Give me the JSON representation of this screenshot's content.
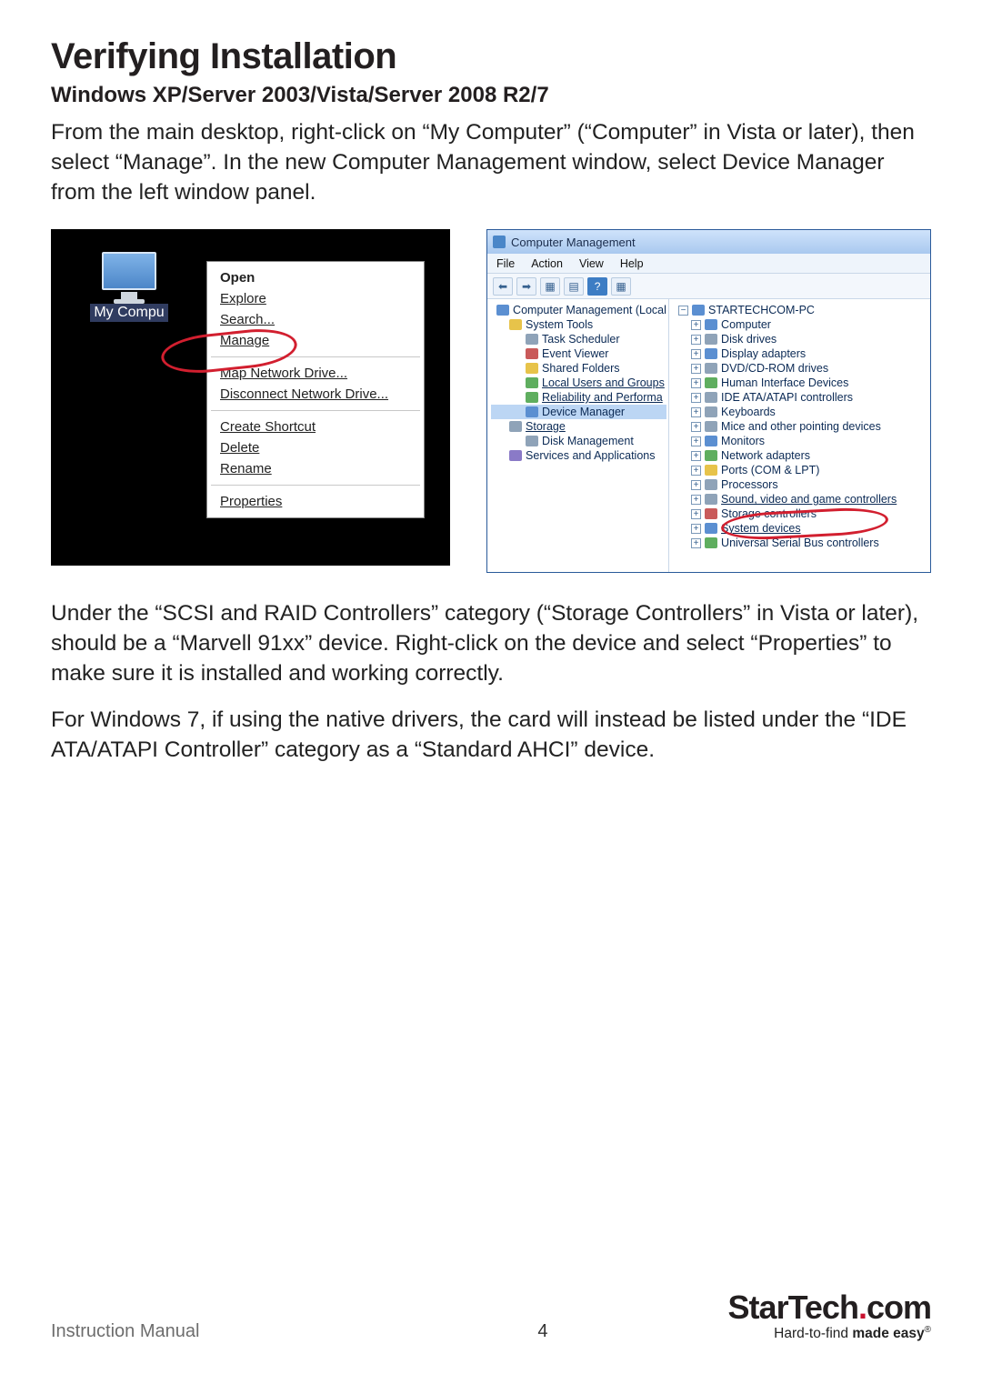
{
  "heading": "Verifying Installation",
  "subheading": "Windows XP/Server 2003/Vista/Server 2008 R2/7",
  "para1": "From the main desktop, right-click on “My Computer” (“Computer” in Vista or later), then select “Manage”. In the new Computer Management window, select Device Manager from the left window panel.",
  "para2": "Under the “SCSI and RAID Controllers” category (“Storage Controllers” in Vista or later), should be a “Marvell 91xx” device.  Right-click on the device and select “Properties” to make sure it is installed and working correctly.",
  "para3": "For Windows 7, if using the native drivers, the card will instead be listed under the “IDE ATA/ATAPI Controller” category as a “Standard AHCI” device.",
  "desktop_icon_label": "My Compu",
  "context_menu": {
    "open": "Open",
    "explore": "Explore",
    "search": "Search...",
    "manage": "Manage",
    "map": "Map Network Drive...",
    "disconnect": "Disconnect Network Drive...",
    "shortcut": "Create Shortcut",
    "delete": "Delete",
    "rename": "Rename",
    "properties": "Properties"
  },
  "cm": {
    "title": "Computer Management",
    "menu": {
      "file": "File",
      "action": "Action",
      "view": "View",
      "help": "Help"
    },
    "left": {
      "root": "Computer Management (Local",
      "system_tools": "System Tools",
      "task_scheduler": "Task Scheduler",
      "event_viewer": "Event Viewer",
      "shared_folders": "Shared Folders",
      "local_users": "Local Users and Groups",
      "reliability": "Reliability and Performa",
      "device_manager": "Device Manager",
      "storage": "Storage",
      "disk_mgmt": "Disk Management",
      "services": "Services and Applications"
    },
    "right": {
      "pc": "STARTECHCOM-PC",
      "computer": "Computer",
      "disk_drives": "Disk drives",
      "display": "Display adapters",
      "dvd": "DVD/CD-ROM drives",
      "hid": "Human Interface Devices",
      "ide": "IDE ATA/ATAPI controllers",
      "keyboards": "Keyboards",
      "mice": "Mice and other pointing devices",
      "monitors": "Monitors",
      "network": "Network adapters",
      "ports": "Ports (COM & LPT)",
      "processors": "Processors",
      "sound": "Sound, video and game controllers",
      "storage_ctrl": "Storage controllers",
      "system_dev": "System devices",
      "usb": "Universal Serial Bus controllers"
    }
  },
  "footer": {
    "label": "Instruction Manual",
    "page": "4",
    "brand_a": "StarTech",
    "brand_b": "com",
    "tag_a": "Hard-to-find ",
    "tag_b": "made easy",
    "reg": "®"
  }
}
